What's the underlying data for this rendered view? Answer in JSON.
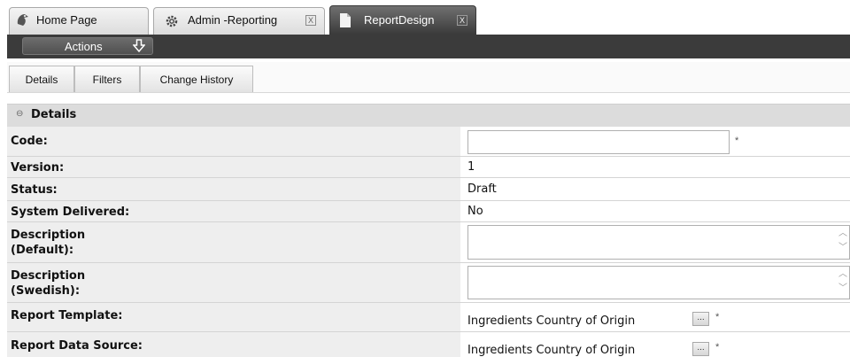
{
  "tabs": [
    {
      "label": "Home Page",
      "icon": "home-icon"
    },
    {
      "label": "Admin -Reporting",
      "icon": "gear-icon",
      "close": "X"
    },
    {
      "label": "ReportDesign",
      "icon": "document-icon",
      "close": "X"
    }
  ],
  "actions": {
    "label": "Actions",
    "icon": "download-arrow-icon"
  },
  "subtabs": [
    "Details",
    "Filters",
    "Change History"
  ],
  "section": {
    "title": "Details",
    "toggle": "⊖"
  },
  "fields": {
    "code": {
      "label": "Code:",
      "value": "",
      "required": "*"
    },
    "version": {
      "label": "Version:",
      "value": "1"
    },
    "status": {
      "label": "Status:",
      "value": "Draft"
    },
    "system_delivered": {
      "label": "System Delivered:",
      "value": "No"
    },
    "description_default": {
      "label_line1": "Description",
      "label_line2": "(Default):",
      "value": ""
    },
    "description_swedish": {
      "label_line1": "Description",
      "label_line2": "(Swedish):",
      "value": ""
    },
    "report_template": {
      "label": "Report Template:",
      "value": "Ingredients Country of Origin",
      "button": "...",
      "required": "*"
    },
    "report_data_source": {
      "label": "Report Data Source:",
      "value": "Ingredients Country of Origin",
      "button": "...",
      "required": "*"
    }
  }
}
